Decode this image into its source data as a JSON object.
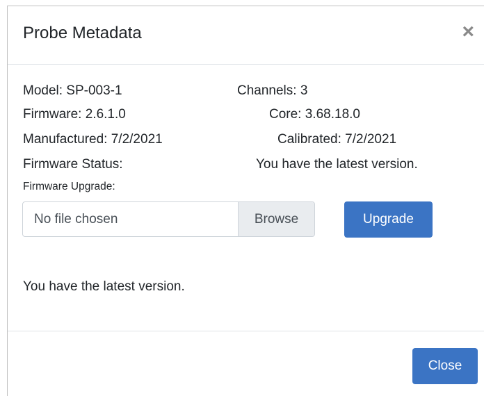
{
  "modal": {
    "title": "Probe Metadata",
    "close_icon": "×"
  },
  "info": {
    "model": "Model: SP-003-1",
    "channels": "Channels: 3",
    "firmware": "Firmware: 2.6.1.0",
    "core": "Core: 3.68.18.0",
    "manufactured": "Manufactured: 7/2/2021",
    "calibrated": "Calibrated: 7/2/2021",
    "firmware_status_label": "Firmware Status:",
    "firmware_status_value": "You have the latest version.",
    "firmware_upgrade_label": "Firmware Upgrade:"
  },
  "upload": {
    "file_placeholder": "No file chosen",
    "browse_label": "Browse",
    "upgrade_label": "Upgrade"
  },
  "status_message": "You have the latest version.",
  "footer": {
    "close_label": "Close"
  },
  "colors": {
    "primary": "#3b74c4",
    "browse_bg": "#e9ecef",
    "close_icon": "#8a8a8a"
  }
}
